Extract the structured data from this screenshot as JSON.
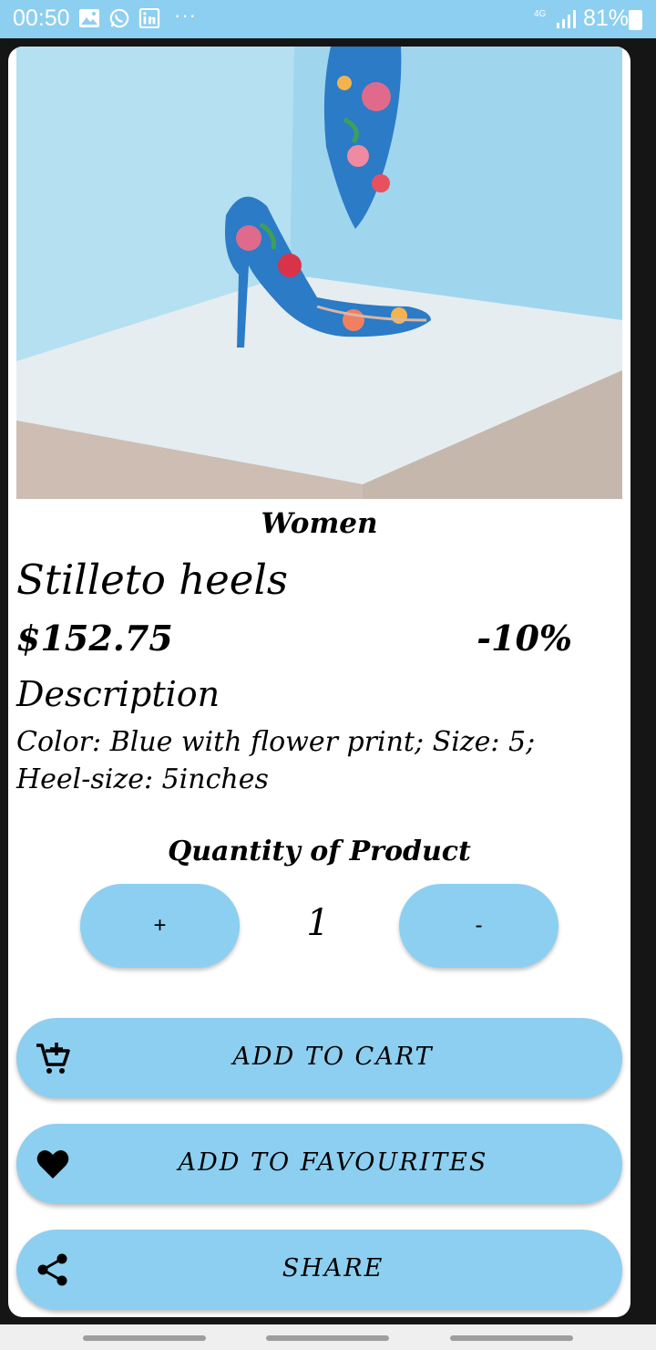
{
  "status_bar": {
    "time": "00:50",
    "notification_icons": [
      "image-icon",
      "whatsapp-icon",
      "linkedin-icon"
    ],
    "more": "···",
    "network": "4G",
    "battery_percent": "81%"
  },
  "product": {
    "image": "shoe-photo",
    "category": "Women",
    "name": "Stilleto heels",
    "price": "$152.75",
    "discount": "-10%",
    "description_heading": "Description",
    "description": "Color: Blue with flower print; Size: 5; Heel-size: 5inches"
  },
  "quantity": {
    "label": "Quantity of Product",
    "increment_label": "+",
    "value": "1",
    "decrement_label": "-"
  },
  "actions": {
    "add_to_cart": "ADD TO CART",
    "add_to_favourites": "ADD TO FAVOURITES",
    "share": "SHARE"
  },
  "icons": {
    "cart": "add-shopping-cart-icon",
    "favourite": "heart-icon",
    "share": "share-icon"
  },
  "colors": {
    "accent": "#8dcff0",
    "status_bar": "#8dcff0",
    "background": "#151515",
    "card": "#ffffff"
  }
}
